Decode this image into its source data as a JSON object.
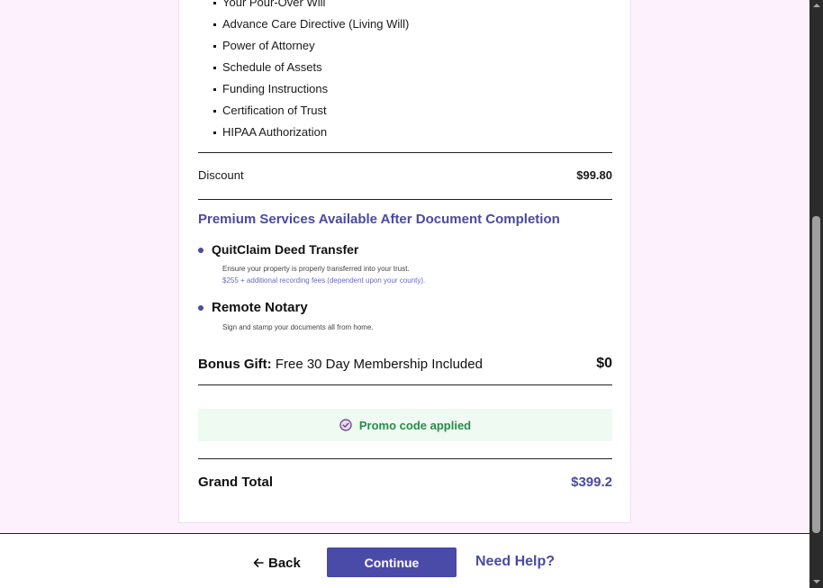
{
  "documents": [
    "Your Pour-Over Will",
    "Advance Care Directive (Living Will)",
    "Power of Attorney",
    "Schedule of Assets",
    "Funding Instructions",
    "Certification of Trust",
    "HIPAA Authorization"
  ],
  "discount": {
    "label": "Discount",
    "value": "$99.80"
  },
  "premium": {
    "heading": "Premium Services Available After Document Completion",
    "services": [
      {
        "title": "QuitClaim Deed Transfer",
        "description": "Ensure your property is properly transferred into your trust.",
        "note": "$255 + additional recording fees (dependent upon your county)."
      },
      {
        "title": "Remote Notary",
        "description": "Sign and stamp your documents all from home."
      }
    ]
  },
  "bonus": {
    "label_bold": "Bonus Gift:",
    "label_rest": " Free 30 Day Membership Included",
    "value": "$0"
  },
  "promo": {
    "text": "Promo code applied",
    "icon": "check-circle-icon"
  },
  "grand_total": {
    "label": "Grand Total",
    "value": "$399.2"
  },
  "footer": {
    "back_label": "Back",
    "continue_label": "Continue",
    "help_label": "Need Help?"
  },
  "colors": {
    "accent": "#4a4aa8",
    "promo_green": "#2a8a4a",
    "promo_bg": "#eefaf2",
    "page_bg": "#fcf1fc"
  }
}
